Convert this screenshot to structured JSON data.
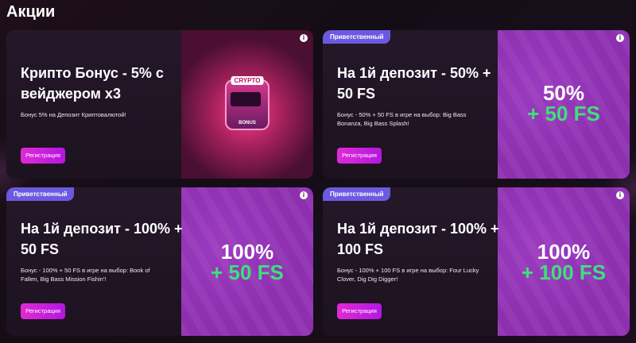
{
  "page": {
    "title": "Акции"
  },
  "cards": [
    {
      "title": "Крипто Бонус - 5% с вейджером x3",
      "description": "Бонус 5% на Депозит Криптовалютой!",
      "button": "Регистрация",
      "badge": "",
      "promo_pct": "",
      "promo_fs": "",
      "art": {
        "sign": "CRYPTO",
        "bonus": "BONUS"
      }
    },
    {
      "badge": "Приветственный",
      "title": "На 1й депозит - 50% + 50 FS",
      "description": "Бонус - 50% + 50 FS в игре на выбор: Big Bass Bonanza, Big Bass Splash!",
      "button": "Регистрация",
      "promo_pct": "50%",
      "promo_fs": "+ 50 FS"
    },
    {
      "badge": "Приветственный",
      "title": "На 1й депозит - 100% + 50 FS",
      "description": "Бонус - 100% + 50 FS в игре на выбор: Book of Fallen, Big Bass Mission Fishin'!",
      "button": "Регистрация",
      "promo_pct": "100%",
      "promo_fs": "+ 50 FS"
    },
    {
      "badge": "Приветственный",
      "title": "На 1й депозит - 100% + 100 FS",
      "description": "Бонус - 100% + 100 FS в игре на выбор: Four Lucky Clover, Dig Dig Digger!",
      "button": "Регистрация",
      "promo_pct": "100%",
      "promo_fs": "+ 100 FS"
    }
  ],
  "icons": {
    "info": "info-icon"
  },
  "colors": {
    "accent_button": "#e02ad6",
    "badge": "#6b5ae0",
    "promo_green": "#3ee07a",
    "promo_panel": "#8e2fb0"
  }
}
